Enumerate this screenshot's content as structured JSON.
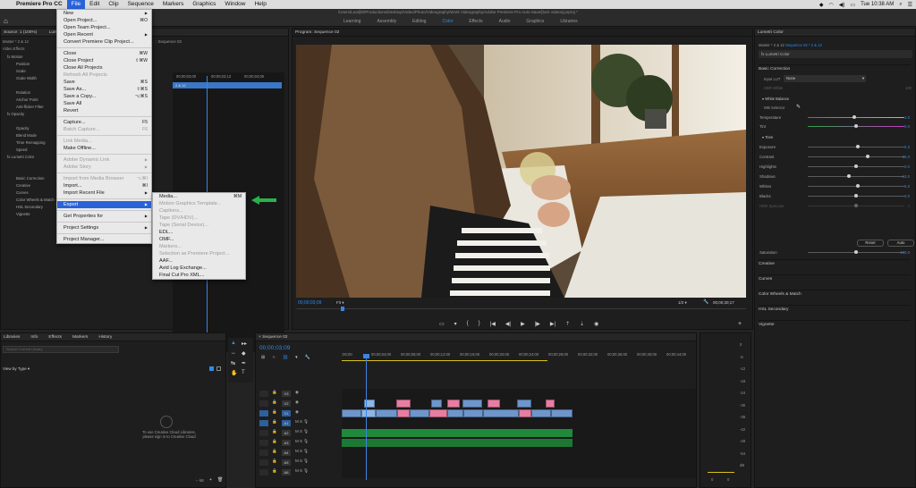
{
  "menubar": {
    "app": "Premiere Pro CC",
    "items": [
      "File",
      "Edit",
      "Clip",
      "Sequence",
      "Markers",
      "Graphics",
      "Window",
      "Help"
    ],
    "active": "File",
    "clock": "Tue 10:38 AM"
  },
  "titlebar": {
    "path": "/Users/Lea@ElProductions/Desktop/Video/Photo/Videography/Work Videography/Adobe Premiere Pro Auto-Save/[lock videos].prproj *"
  },
  "workspaces": [
    "Learning",
    "Assembly",
    "Editing",
    "Color",
    "Effects",
    "Audio",
    "Graphics",
    "Libraries"
  ],
  "workspace_active": "Color",
  "file_menu": {
    "items": [
      {
        "label": "New",
        "shortcut": "",
        "arrow": true,
        "disabled": false
      },
      {
        "label": "Open Project...",
        "shortcut": "⌘O",
        "disabled": false
      },
      {
        "label": "Open Team Project...",
        "shortcut": "",
        "disabled": false
      },
      {
        "label": "Open Recent",
        "shortcut": "",
        "arrow": true,
        "disabled": false
      },
      {
        "label": "Convert Premiere Clip Project...",
        "shortcut": "",
        "disabled": false
      },
      {
        "sep": true
      },
      {
        "label": "Close",
        "shortcut": "⌘W",
        "disabled": false
      },
      {
        "label": "Close Project",
        "shortcut": "⇧⌘W",
        "disabled": false
      },
      {
        "label": "Close All Projects",
        "shortcut": "",
        "disabled": false
      },
      {
        "label": "Refresh All Projects",
        "shortcut": "",
        "disabled": true
      },
      {
        "label": "Save",
        "shortcut": "⌘S",
        "disabled": false
      },
      {
        "label": "Save As...",
        "shortcut": "⇧⌘S",
        "disabled": false
      },
      {
        "label": "Save a Copy...",
        "shortcut": "⌥⌘S",
        "disabled": false
      },
      {
        "label": "Save All",
        "shortcut": "",
        "disabled": false
      },
      {
        "label": "Revert",
        "shortcut": "",
        "disabled": false
      },
      {
        "sep": true
      },
      {
        "label": "Capture...",
        "shortcut": "F5",
        "disabled": false
      },
      {
        "label": "Batch Capture...",
        "shortcut": "F6",
        "disabled": true
      },
      {
        "sep": true
      },
      {
        "label": "Link Media...",
        "shortcut": "",
        "disabled": true
      },
      {
        "label": "Make Offline...",
        "shortcut": "",
        "disabled": false
      },
      {
        "sep": true
      },
      {
        "label": "Adobe Dynamic Link",
        "shortcut": "",
        "arrow": true,
        "disabled": true
      },
      {
        "label": "Adobe Story",
        "shortcut": "",
        "arrow": true,
        "disabled": true
      },
      {
        "sep": true
      },
      {
        "label": "Import from Media Browser",
        "shortcut": "⌥⌘I",
        "disabled": true
      },
      {
        "label": "Import...",
        "shortcut": "⌘I",
        "disabled": false
      },
      {
        "label": "Import Recent File",
        "shortcut": "",
        "arrow": true,
        "disabled": false
      },
      {
        "sep": true
      },
      {
        "label": "Export",
        "shortcut": "",
        "arrow": true,
        "disabled": false,
        "highlighted": true
      },
      {
        "sep": true
      },
      {
        "label": "Get Properties for",
        "shortcut": "",
        "arrow": true,
        "disabled": false
      },
      {
        "sep": true
      },
      {
        "label": "Project Settings",
        "shortcut": "",
        "arrow": true,
        "disabled": false
      },
      {
        "sep": true
      },
      {
        "label": "Project Manager...",
        "shortcut": "",
        "disabled": false
      }
    ]
  },
  "export_menu": {
    "items": [
      {
        "label": "Media...",
        "shortcut": "⌘M",
        "disabled": false
      },
      {
        "label": "Motion Graphics Template...",
        "disabled": true
      },
      {
        "label": "Captions...",
        "disabled": true
      },
      {
        "label": "Tape (DV/HDV)...",
        "disabled": true
      },
      {
        "label": "Tape (Serial Device)...",
        "disabled": true
      },
      {
        "label": "EDL...",
        "disabled": false
      },
      {
        "label": "OMF...",
        "disabled": false
      },
      {
        "label": "Markers...",
        "disabled": true
      },
      {
        "label": "Selection as Premiere Project...",
        "disabled": true
      },
      {
        "label": "AAF...",
        "disabled": false
      },
      {
        "label": "Avid Log Exchange...",
        "disabled": false
      },
      {
        "label": "Final Cut Pro XML...",
        "disabled": false
      }
    ]
  },
  "source_panel": {
    "tab": "Source: 1 (100%)",
    "tab2": "Lum",
    "seq_tab": "Sequence 02",
    "clip_name": "Master * 2 & 12",
    "clip_short": "2 & 12",
    "timecodes": [
      "00;00;03;00",
      "00;00;03;13",
      "00;00;04;00"
    ],
    "video_effects": "Video Effects",
    "rows": [
      "fx Motion",
      "Position",
      "Scale",
      "Scale Width",
      "",
      "Rotation",
      "Anchor Point",
      "Anti-flicker Filter",
      "fx Opacity",
      "",
      "Opacity",
      "Blend Mode",
      "Time Remapping",
      "Speed",
      "fx Lumetri Color",
      "",
      "",
      "Basic Correction",
      "Creative",
      "Curves",
      "Color Wheels & Match",
      "HSL Secondary",
      "Vignette"
    ],
    "bottom_tc": "00;00;03;09"
  },
  "program": {
    "title": "Program: Sequence 02",
    "timecode": "00;00;03;09",
    "fit": "Fit",
    "ratio": "1/2",
    "duration": "00;00;30;17"
  },
  "lumetri": {
    "title": "Lumetri Color",
    "master": "Master * 2 & 12",
    "sequence": "Sequence 02 * 2 & 12",
    "effect": "Lumetri Color",
    "basic": "Basic Correction",
    "input_lut_label": "Input LUT",
    "input_lut_value": "None",
    "hdr_white_label": "HDR White",
    "hdr_white_value": "100",
    "white_balance": "White Balance",
    "wb_selector": "WB Selector",
    "tone": "Tone",
    "temperature": {
      "label": "Temperature",
      "value": "-1.0",
      "pos": 0.48
    },
    "tint": {
      "label": "Tint",
      "value": "0.0",
      "pos": 0.5
    },
    "sliders": [
      {
        "label": "Exposure",
        "value": "0.3",
        "pos": 0.52
      },
      {
        "label": "Contrast",
        "value": "26.0",
        "pos": 0.62
      },
      {
        "label": "Highlights",
        "value": "0.0",
        "pos": 0.5
      },
      {
        "label": "Shadows",
        "value": "-13.0",
        "pos": 0.43
      },
      {
        "label": "Whites",
        "value": "5.0",
        "pos": 0.52
      },
      {
        "label": "Blacks",
        "value": "0.0",
        "pos": 0.5
      },
      {
        "label": "HDR Specular",
        "value": "0",
        "pos": 0.5
      }
    ],
    "reset": "Reset",
    "auto": "Auto",
    "saturation": {
      "label": "Saturation",
      "value": "100.0",
      "pos": 0.5
    },
    "sections": [
      "Creative",
      "Curves",
      "Color Wheels & Match",
      "HSL Secondary",
      "Vignette"
    ]
  },
  "libraries": {
    "tabs": [
      "Libraries",
      "Info",
      "Effects",
      "Markers",
      "History"
    ],
    "search_placeholder": "Search Current Library",
    "view_by": "View by Type",
    "message_line1": "To use Creative Cloud Libraries,",
    "message_line2": "please sign in to Creative Cloud",
    "footer": "-- kB"
  },
  "timeline": {
    "title": "Sequence 02",
    "timecode": "00;00;03;09",
    "ruler": [
      ";00;00",
      "00;00;04;00",
      "00;00;08;00",
      "00;00;12;00",
      "00;00;16;00",
      "00;00;20;00",
      "00;00;24;00",
      "00;00;28;00",
      "00;00;32;00",
      "00;00;36;00",
      "00;00;40;00",
      "00;00;44;00"
    ],
    "tracks": [
      "V3",
      "V2",
      "V1",
      "A1",
      "A2",
      "A3",
      "A4",
      "A5",
      "A6"
    ],
    "meter_labels": [
      "0",
      "-6",
      "-12",
      "-18",
      "-24",
      "-30",
      "-36",
      "-42",
      "-48",
      "-54",
      "dB"
    ],
    "meter_footer": [
      "0",
      "0"
    ]
  }
}
